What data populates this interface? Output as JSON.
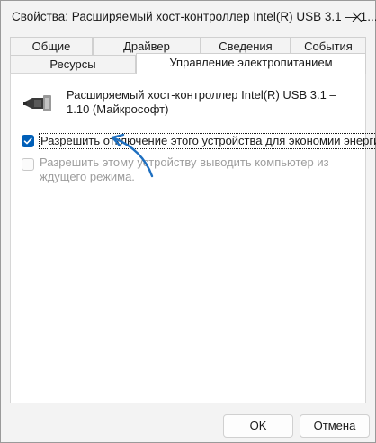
{
  "window": {
    "title": "Свойства: Расширяемый хост-контроллер Intel(R) USB 3.1 — 1...."
  },
  "tabs": {
    "row1": [
      "Общие",
      "Драйвер",
      "Сведения",
      "События"
    ],
    "row2": [
      "Ресурсы",
      "Управление электропитанием"
    ],
    "active": "Управление электропитанием"
  },
  "device": {
    "icon": "usb-connector-icon",
    "name": "Расширяемый хост-контроллер Intel(R) USB 3.1 – 1.10 (Майкрософт)"
  },
  "options": {
    "allow_turn_off": {
      "label": "Разрешить отключение этого устройства для экономии энергии.",
      "checked": true
    },
    "allow_wake": {
      "label": "Разрешить этому устройству выводить компьютер из ждущего режима.",
      "checked": false,
      "enabled": false
    }
  },
  "buttons": {
    "ok": "OK",
    "cancel": "Отмена"
  },
  "colors": {
    "accent": "#005fb8",
    "annotation_arrow": "#1e6fc0"
  }
}
